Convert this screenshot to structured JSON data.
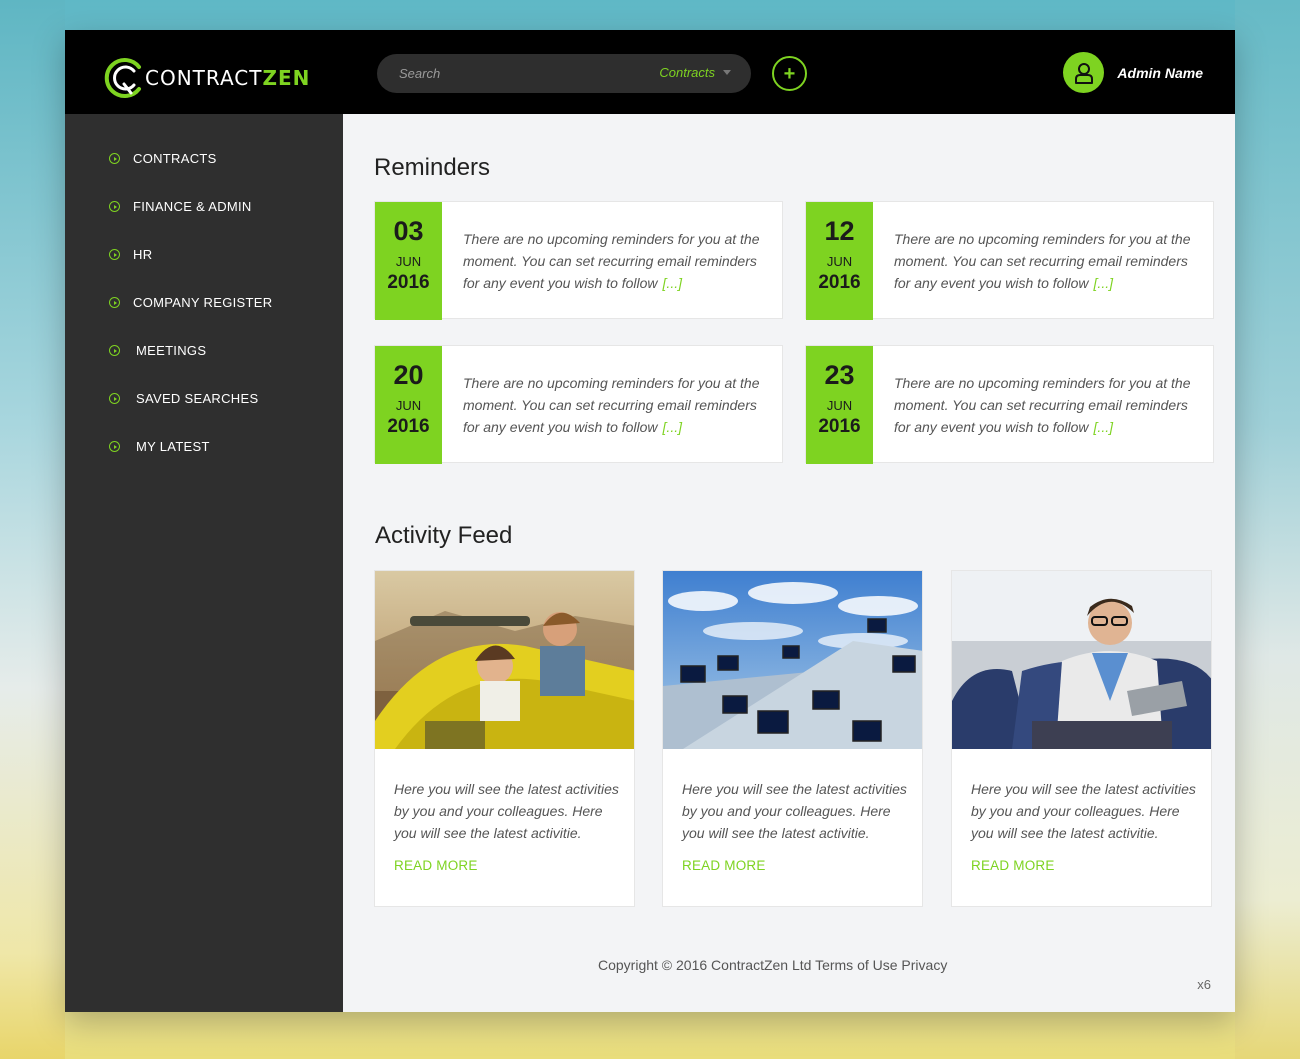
{
  "brand": {
    "logo_prefix": "CONTRACT",
    "logo_suffix": "ZEN",
    "accent": "#7ed321"
  },
  "header": {
    "search_placeholder": "Search",
    "search_scope": "Contracts",
    "add_icon": "plus-icon",
    "user_icon": "user-icon",
    "user_name": "Admin Name"
  },
  "sidebar": {
    "items": [
      {
        "label": "CONTRACTS"
      },
      {
        "label": "FINANCE & ADMIN"
      },
      {
        "label": "HR"
      },
      {
        "label": "COMPANY REGISTER"
      },
      {
        "label": "MEETINGS"
      },
      {
        "label": "SAVED SEARCHES"
      },
      {
        "label": "MY LATEST"
      }
    ]
  },
  "reminders": {
    "title": "Reminders",
    "items": [
      {
        "day": "03",
        "month": "JUN",
        "year": "2016",
        "text": "There are no upcoming reminders for you at the moment. You can set recurring email reminders for any event you wish to follow",
        "more": "[...]"
      },
      {
        "day": "12",
        "month": "JUN",
        "year": "2016",
        "text": "There are no upcoming reminders for you at the moment. You can set recurring email reminders for any event you wish to follow",
        "more": "[...]"
      },
      {
        "day": "20",
        "month": "JUN",
        "year": "2016",
        "text": "There are no upcoming reminders for you at the moment. You can set recurring email reminders for any event you wish to follow",
        "more": "[...]"
      },
      {
        "day": "23",
        "month": "JUN",
        "year": "2016",
        "text": "There are no upcoming reminders for you at the moment. You can set recurring email reminders for any event you wish to follow",
        "more": "[...]"
      }
    ]
  },
  "activity": {
    "title": "Activity Feed",
    "items": [
      {
        "text": "Here you will see the latest activities by you and your colleagues. Here you will see the latest activitie.",
        "link": "READ MORE"
      },
      {
        "text": "Here you will see the latest activities by you and your colleagues. Here you will see the latest activitie.",
        "link": "READ MORE"
      },
      {
        "text": "Here you will see the latest activities by you and your colleagues. Here you will see the latest activitie.",
        "link": "READ MORE"
      }
    ]
  },
  "footer": {
    "copyright": "Copyright © 2016 ContractZen Ltd Terms of Use Privacy",
    "version": "x6"
  }
}
